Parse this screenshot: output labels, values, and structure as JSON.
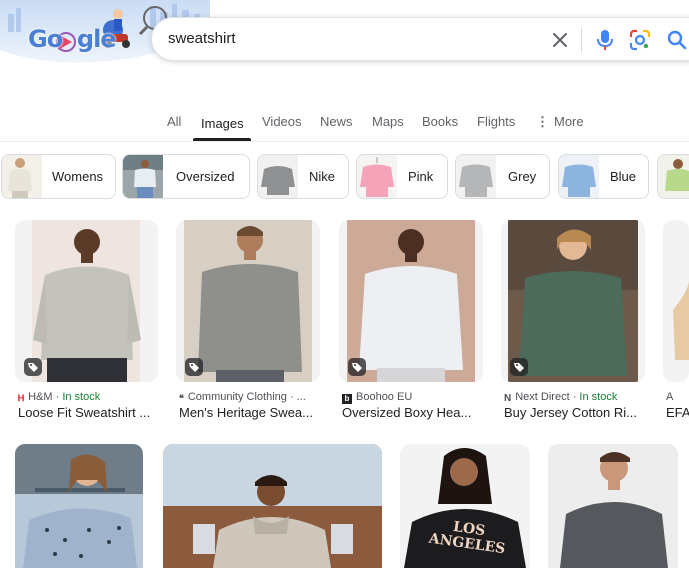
{
  "search": {
    "query": "sweatshirt"
  },
  "doodle": {
    "alt": "Google"
  },
  "tabs": [
    {
      "label": "All"
    },
    {
      "label": "Images"
    },
    {
      "label": "Videos"
    },
    {
      "label": "News"
    },
    {
      "label": "Maps"
    },
    {
      "label": "Books"
    },
    {
      "label": "Flights"
    },
    {
      "label": "More"
    }
  ],
  "chips": [
    {
      "label": "Womens"
    },
    {
      "label": "Oversized"
    },
    {
      "label": "Nike"
    },
    {
      "label": "Pink"
    },
    {
      "label": "Grey"
    },
    {
      "label": "Blue"
    }
  ],
  "results": [
    {
      "source": "H&M",
      "stock": "In stock",
      "title": "Loose Fit Sweatshirt ..."
    },
    {
      "source": "Community Clothing · ...",
      "stock": "",
      "title": "Men's Heritage Swea..."
    },
    {
      "source": "Boohoo EU",
      "stock": "",
      "title": "Oversized Boxy Hea..."
    },
    {
      "source": "Next Direct",
      "stock": "In stock",
      "title": "Buy Jersey Cotton Ri..."
    },
    {
      "source": "A",
      "stock": "",
      "title": "EFA"
    }
  ],
  "row2_overlay": {
    "text": "LOS ANGELES"
  },
  "colors": {
    "accent": "#1a73e8",
    "stock_green": "#188038",
    "hm_red": "#e50010"
  }
}
